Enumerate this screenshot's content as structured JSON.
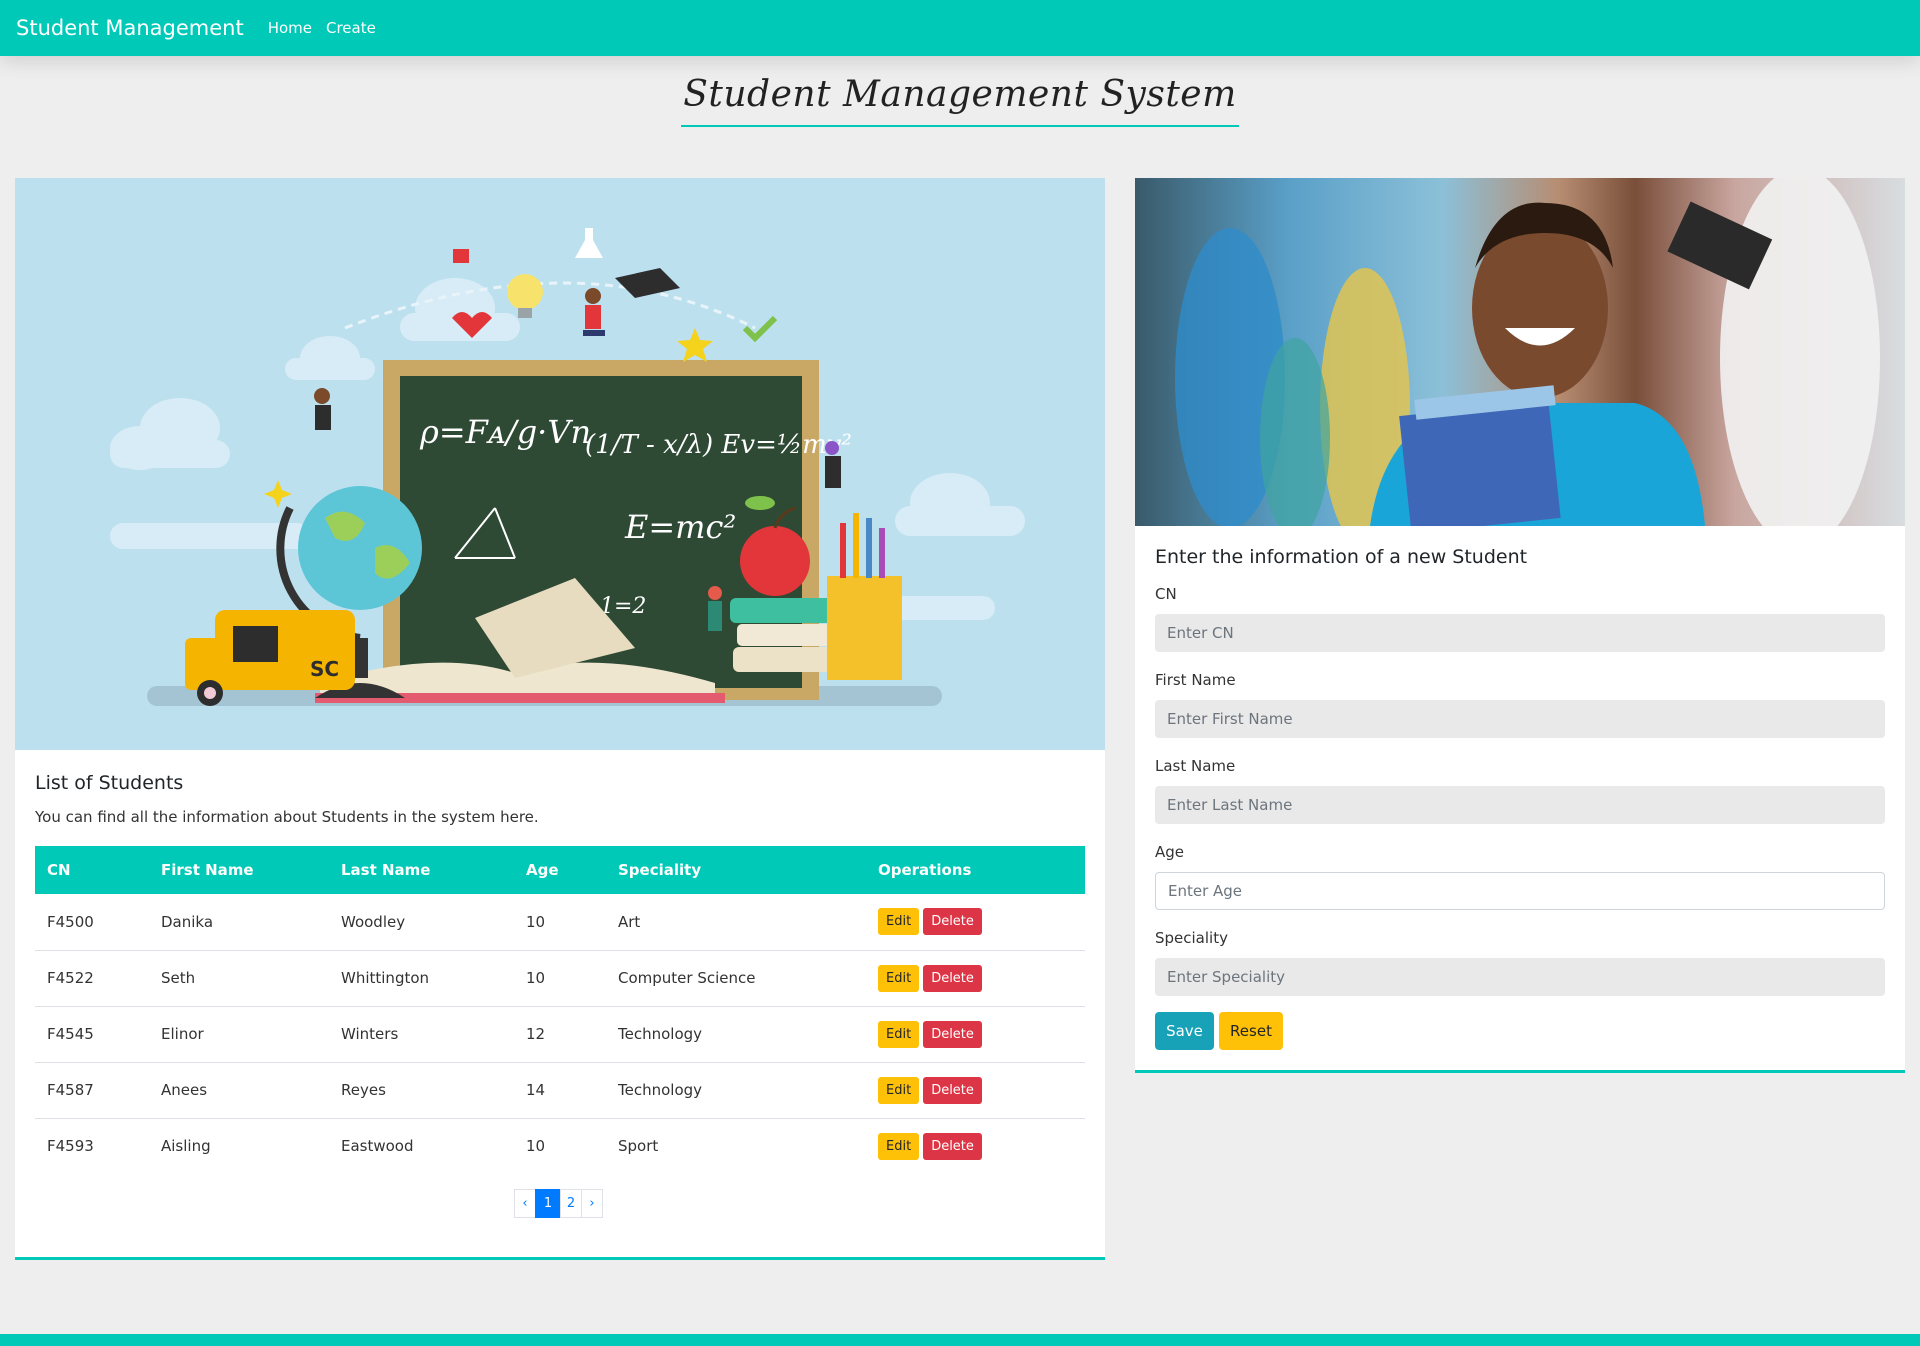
{
  "navbar": {
    "brand": "Student Management",
    "links": [
      "Home",
      "Create"
    ]
  },
  "page_title": "Student Management System",
  "list": {
    "title": "List of Students",
    "subtitle": "You can find all the information about Students in the system here.",
    "columns": [
      "CN",
      "First Name",
      "Last Name",
      "Age",
      "Speciality",
      "Operations"
    ],
    "rows": [
      {
        "cn": "F4500",
        "first": "Danika",
        "last": "Woodley",
        "age": "10",
        "speciality": "Art"
      },
      {
        "cn": "F4522",
        "first": "Seth",
        "last": "Whittington",
        "age": "10",
        "speciality": "Computer Science"
      },
      {
        "cn": "F4545",
        "first": "Elinor",
        "last": "Winters",
        "age": "12",
        "speciality": "Technology"
      },
      {
        "cn": "F4587",
        "first": "Anees",
        "last": "Reyes",
        "age": "14",
        "speciality": "Technology"
      },
      {
        "cn": "F4593",
        "first": "Aisling",
        "last": "Eastwood",
        "age": "10",
        "speciality": "Sport"
      }
    ],
    "edit_label": "Edit",
    "delete_label": "Delete",
    "pagination": {
      "prev": "‹",
      "pages": [
        "1",
        "2"
      ],
      "next": "›",
      "active": "1"
    }
  },
  "form": {
    "title": "Enter the information of a new Student",
    "fields": [
      {
        "label": "CN",
        "placeholder": "Enter CN"
      },
      {
        "label": "First Name",
        "placeholder": "Enter First Name"
      },
      {
        "label": "Last Name",
        "placeholder": "Enter Last Name"
      },
      {
        "label": "Age",
        "placeholder": "Enter Age"
      },
      {
        "label": "Speciality",
        "placeholder": "Enter Speciality"
      }
    ],
    "save_label": "Save",
    "reset_label": "Reset"
  },
  "colors": {
    "accent": "#00c9b7",
    "edit": "#ffc107",
    "delete": "#dc3545",
    "save": "#17a2b8",
    "page_active": "#007bff"
  },
  "images": {
    "left_hero": "school-illustration",
    "right_hero": "smiling-student-photo"
  },
  "chalkboard": {
    "line1": "ρ=Fᴀ/g·Vn",
    "line2": "(1/T - x/λ) Ev=½mv²",
    "line3": "E=mc²",
    "line4": "1=2"
  },
  "bus_text": "SC"
}
